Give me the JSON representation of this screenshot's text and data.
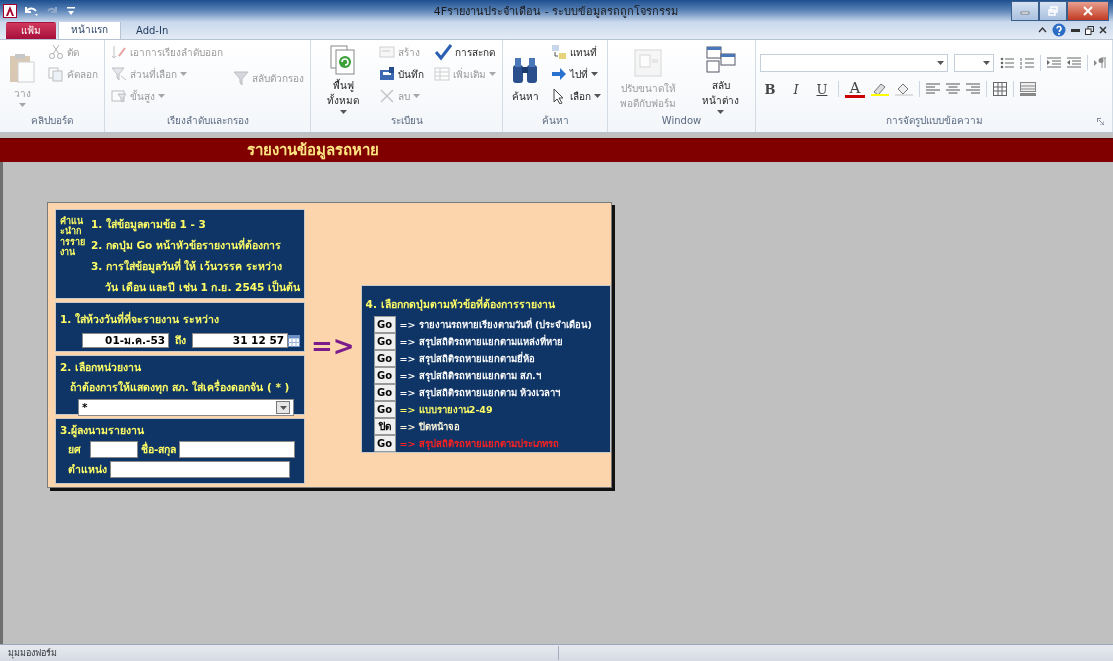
{
  "window": {
    "title": "4Fรายงานประจำเดือน - ระบบข้อมูลรถถูกโจรกรรม"
  },
  "tabs": [
    {
      "label": "แฟ้ม",
      "kind": "file",
      "selected": false
    },
    {
      "label": "หน้าแรก",
      "kind": "tab",
      "selected": true
    },
    {
      "label": "Add-In",
      "kind": "tab",
      "selected": false
    }
  ],
  "ribbon_groups": [
    {
      "label": "คลิปบอร์ด",
      "columns": [
        [
          {
            "label": "วาง",
            "kind": "large",
            "disabled": true,
            "dropdown": true
          }
        ],
        [
          {
            "label": "ตัด",
            "kind": "small",
            "disabled": true,
            "dropdown": false
          },
          {
            "label": "คัดลอก",
            "kind": "small",
            "disabled": true,
            "dropdown": false
          }
        ]
      ]
    },
    {
      "label": "เรียงลำดับและกรอง",
      "columns": [
        [
          {
            "label": "เอาการเรียงลำดับออก",
            "kind": "small",
            "disabled": true,
            "dropdown": false
          },
          {
            "label": "ส่วนที่เลือก",
            "kind": "small",
            "disabled": true,
            "dropdown": true
          },
          {
            "label": "ขั้นสูง",
            "kind": "small",
            "disabled": true,
            "dropdown": true
          }
        ],
        [
          {
            "label": "สลับตัวกรอง",
            "kind": "small",
            "disabled": true,
            "dropdown": false
          }
        ]
      ]
    },
    {
      "label": "ระเบียน",
      "columns": [
        [
          {
            "label": "พื้นฟู ทั้งหมด",
            "kind": "large",
            "disabled": false,
            "dropdown": true
          }
        ],
        [
          {
            "label": "สร้าง",
            "kind": "small",
            "disabled": true,
            "dropdown": false
          },
          {
            "label": "บันทึก",
            "kind": "small",
            "disabled": false,
            "dropdown": false
          },
          {
            "label": "ลบ",
            "kind": "small",
            "disabled": true,
            "dropdown": true
          }
        ],
        [
          {
            "label": "การสะกด",
            "kind": "small",
            "disabled": false,
            "dropdown": false
          },
          {
            "label": "เพิ่มเติม",
            "kind": "small",
            "disabled": true,
            "dropdown": true
          }
        ]
      ]
    },
    {
      "label": "ค้นหา",
      "columns": [
        [
          {
            "label": "ค้นหา",
            "kind": "large",
            "disabled": false,
            "dropdown": false
          }
        ],
        [
          {
            "label": "แทนที่",
            "kind": "small",
            "disabled": false,
            "dropdown": false
          },
          {
            "label": "ไปที่",
            "kind": "small",
            "disabled": false,
            "dropdown": true
          },
          {
            "label": "เลือก",
            "kind": "small",
            "disabled": false,
            "dropdown": true
          }
        ]
      ]
    },
    {
      "label": "Window",
      "columns": [
        [
          {
            "label": "ปรับขนาดให้ พอดีกับฟอร์ม",
            "kind": "large",
            "disabled": true,
            "dropdown": false
          }
        ],
        [
          {
            "label": "สลับ หน้าต่าง",
            "kind": "large",
            "disabled": false,
            "dropdown": true
          }
        ]
      ]
    }
  ],
  "text_format": {
    "label": "การจัดรูปแบบข้อความ",
    "buttons": [
      {
        "label": "B"
      },
      {
        "label": "I"
      },
      {
        "label": "U"
      },
      {
        "label": "A"
      }
    ]
  },
  "header": {
    "title": "รายงานข้อมูลรถหาย"
  },
  "instructions": {
    "heading": "คำแนะนำการรายงาน",
    "lines": [
      {
        "text": "1. ใส่ข้อมูลตามข้อ 1 - 3",
        "kind": "item"
      },
      {
        "text": "2. กดปุ่ม Go หน้าหัวข้อรายงานที่ต้องการ",
        "kind": "item"
      },
      {
        "text": "3. การใส่ข้อมูลวันที่ ให้ เว้นวรรค ระหว่าง",
        "kind": "item"
      },
      {
        "text": "วัน เดือน และปี เช่น 1 ก.ย. 2545 เป็นต้น",
        "kind": "continuation"
      }
    ]
  },
  "date_range": {
    "label": "1. ใส่ห้วงวันที่ที่จะรายงาน  ระหว่าง",
    "from": "01-ม.ค.-53",
    "to_label": "ถึง",
    "to": "31 12 57"
  },
  "unit": {
    "label": "2. เลือกหน่วยงาน",
    "hint": "ถ้าต้องการให้แสดงทุก สภ. ใส่เครื่องดอกจัน ( * )",
    "value": "*"
  },
  "signer": {
    "label": "3.ผู้ลงนามรายงาน",
    "rank_label": "ยศ",
    "name_label": "ชื่อ-สกุล",
    "position_label": "ตำแหน่ง"
  },
  "arrow": "=>",
  "reports": {
    "heading": "4. เลือกกดปุ่มตามหัวข้อที่ต้องการรายงาน",
    "items": [
      {
        "button": "Go",
        "label": "=> รายงานรถหายเรียงตามวันที่ (ประจำเดือน)",
        "color": "#ffffff"
      },
      {
        "button": "Go",
        "label": "=> สรุปสถิติรถหายแยกตามแหล่งที่หาย",
        "color": "#ffffff"
      },
      {
        "button": "Go",
        "label": "=> สรุปสถิติรถหายแยกตามยี่ห้อ",
        "color": "#ffffff"
      },
      {
        "button": "Go",
        "label": "=> สรุปสถิติรถหายแยกตาม สภ.ฯ",
        "color": "#ffffff"
      },
      {
        "button": "Go",
        "label": "=> สรุปสถิติรถหายแยกตาม ห้วงเวลาฯ",
        "color": "#ffffff"
      },
      {
        "button": "Go",
        "label": "=> แบบรายงาน2-49",
        "color": "#ffff66"
      },
      {
        "button": "ปิด",
        "label": "=> ปิดหน้าจอ",
        "color": "#fff8dc"
      },
      {
        "button": "Go",
        "label": "=> สรุปสถิติรถหายแยกตามประเภทรถ",
        "color": "#ff2020"
      }
    ]
  },
  "status_bar": {
    "text": "มุมมองฟอร์ม"
  }
}
